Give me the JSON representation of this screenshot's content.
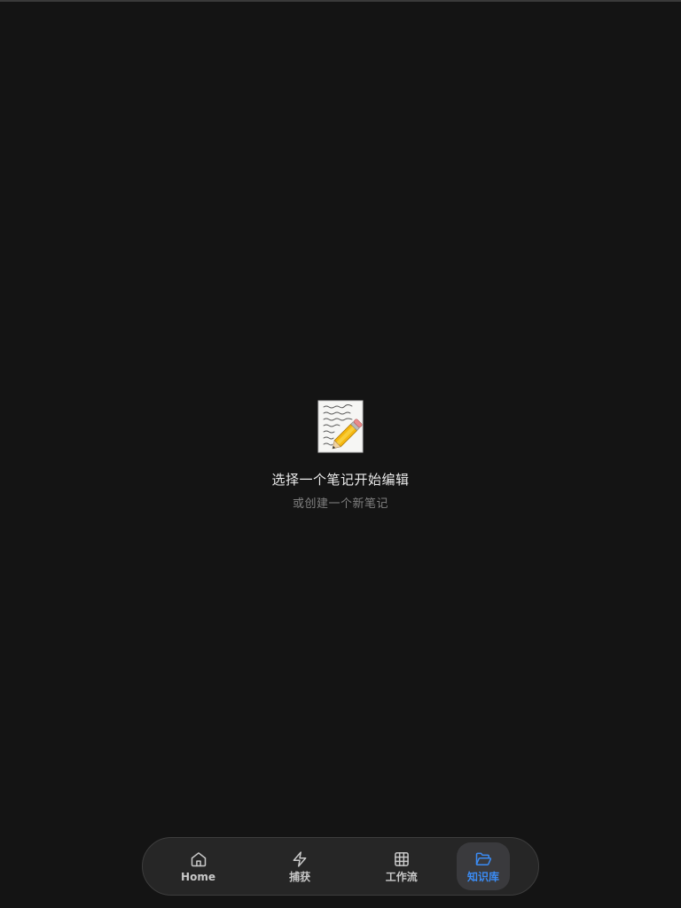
{
  "empty_state": {
    "icon": "memo-pencil-icon",
    "title": "选择一个笔记开始编辑",
    "subtitle": "或创建一个新笔记"
  },
  "bottom_nav": {
    "active_index": 3,
    "accent_color": "#3b8cf5",
    "items": [
      {
        "label": "Home",
        "icon": "home-icon"
      },
      {
        "label": "捕获",
        "icon": "lightning-icon"
      },
      {
        "label": "工作流",
        "icon": "grid-icon"
      },
      {
        "label": "知识库",
        "icon": "folder-open-icon"
      }
    ]
  }
}
